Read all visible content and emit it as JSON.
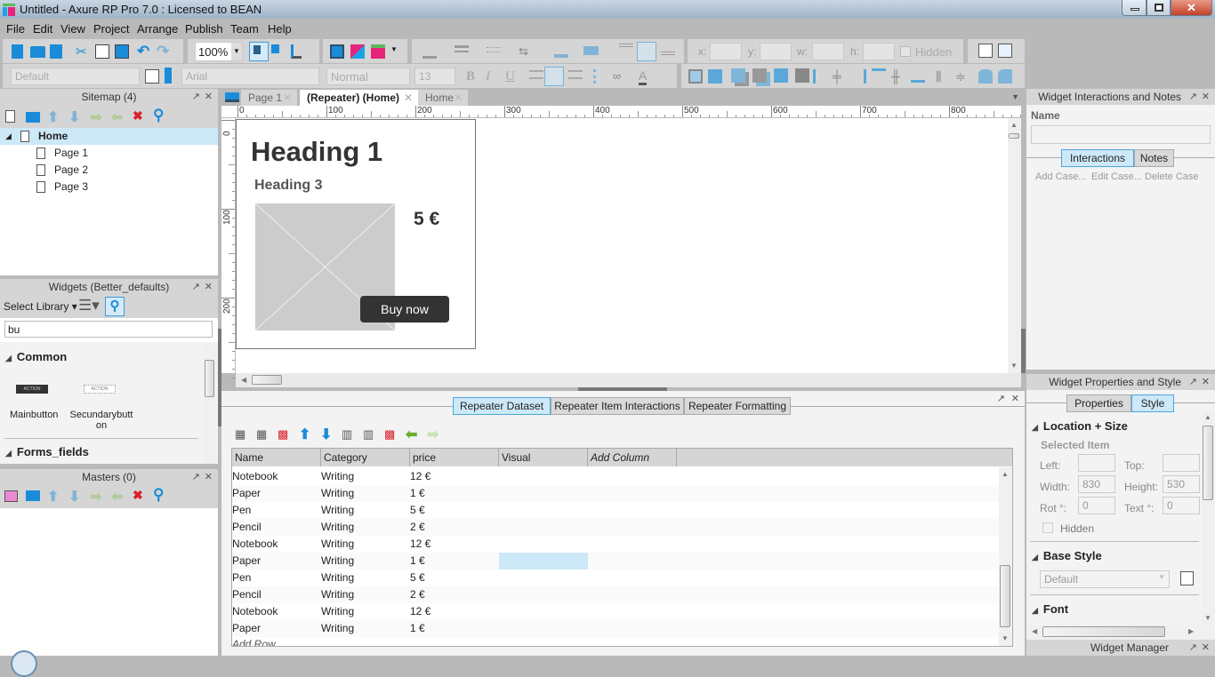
{
  "window": {
    "title": "Untitled - Axure RP Pro 7.0 : Licensed to BEAN",
    "close_symbol": "✕"
  },
  "menu": [
    "File",
    "Edit",
    "View",
    "Project",
    "Arrange",
    "Publish",
    "Team",
    "Help"
  ],
  "toolbar": {
    "zoom_value": "100%",
    "style_select": "Default",
    "font_select": "Arial",
    "weight_select": "Normal",
    "size_select": "13",
    "bold": "B",
    "italic": "I",
    "underline": "U",
    "text_color": "A",
    "x_label": "x:",
    "y_label": "y:",
    "w_label": "w:",
    "h_label": "h:",
    "hidden_label": "Hidden"
  },
  "sitemap": {
    "title": "Sitemap (4)",
    "root": "Home",
    "pages": [
      "Page 1",
      "Page 2",
      "Page 3"
    ]
  },
  "widgets": {
    "title": "Widgets (Better_defaults)",
    "library_label": "Select Library",
    "search_value": "bu",
    "groups": [
      {
        "name": "Common",
        "items": [
          {
            "label": "Mainbutton",
            "preview": "ACTION"
          },
          {
            "label": "Secundarybutton",
            "preview": "ACTION"
          }
        ]
      },
      {
        "name": "Forms_fields",
        "items": []
      }
    ]
  },
  "masters": {
    "title": "Masters (0)"
  },
  "tabs": [
    {
      "label": "Page 1",
      "active": false
    },
    {
      "label": "(Repeater) (Home)",
      "active": true
    },
    {
      "label": "Home",
      "active": false
    }
  ],
  "ruler": {
    "h_ticks": [
      "0",
      "100",
      "200",
      "300",
      "400",
      "500",
      "600",
      "700",
      "800"
    ],
    "v_ticks": [
      "0",
      "100",
      "200"
    ]
  },
  "canvas": {
    "heading1": "Heading 1",
    "heading3": "Heading 3",
    "price": "5 €",
    "button_label": "Buy now"
  },
  "repeater": {
    "tabs": [
      {
        "label": "Repeater Dataset",
        "active": true
      },
      {
        "label": "Repeater Item Interactions",
        "active": false
      },
      {
        "label": "Repeater Formatting",
        "active": false
      }
    ],
    "columns": [
      "Name",
      "Category",
      "price",
      "Visual",
      "Add Column"
    ],
    "rows": [
      [
        "Notebook",
        "Writing",
        "12 €"
      ],
      [
        "Paper",
        "Writing",
        "1 €"
      ],
      [
        "Pen",
        "Writing",
        "5 €"
      ],
      [
        "Pencil",
        "Writing",
        "2 €"
      ],
      [
        "Notebook",
        "Writing",
        "12 €"
      ],
      [
        "Paper",
        "Writing",
        "1 €"
      ],
      [
        "Pen",
        "Writing",
        "5 €"
      ],
      [
        "Pencil",
        "Writing",
        "2 €"
      ],
      [
        "Notebook",
        "Writing",
        "12 €"
      ],
      [
        "Paper",
        "Writing",
        "1 €"
      ]
    ],
    "add_row": "Add Row"
  },
  "interactions_panel": {
    "title": "Widget Interactions and Notes",
    "name_label": "Name",
    "name_value": "",
    "tabs": [
      {
        "label": "Interactions",
        "active": true
      },
      {
        "label": "Notes",
        "active": false
      }
    ],
    "actions": [
      "Add Case...",
      "Edit Case...",
      "Delete Case"
    ]
  },
  "properties_panel": {
    "title": "Widget Properties and Style",
    "tabs": [
      {
        "label": "Properties",
        "active": false
      },
      {
        "label": "Style",
        "active": true
      }
    ],
    "location_size": {
      "title": "Location + Size",
      "subtitle": "Selected Item",
      "left_label": "Left:",
      "left": "",
      "top_label": "Top:",
      "top": "",
      "width_label": "Width:",
      "width": "830",
      "height_label": "Height:",
      "height": "530",
      "rot_label": "Rot °:",
      "rot": "0",
      "text_label": "Text °:",
      "text_rot": "0",
      "hidden_label": "Hidden"
    },
    "base_style": {
      "title": "Base Style",
      "value": "Default"
    },
    "font": {
      "title": "Font"
    }
  },
  "widget_manager": {
    "title": "Widget Manager"
  }
}
